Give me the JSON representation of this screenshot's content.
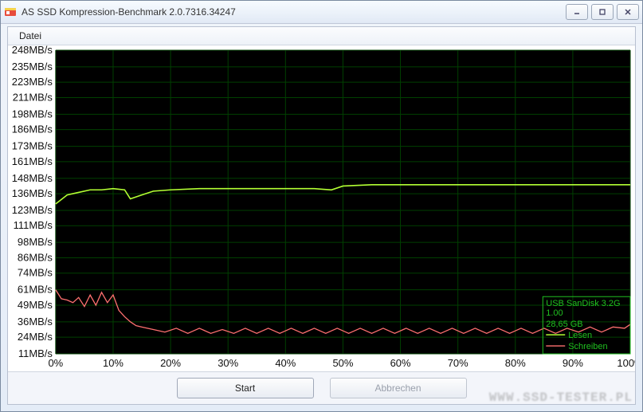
{
  "window": {
    "title": "AS SSD Kompression-Benchmark 2.0.7316.34247"
  },
  "menubar": {
    "file": "Datei"
  },
  "buttons": {
    "start": "Start",
    "cancel": "Abbrechen"
  },
  "legend": {
    "line1": "USB   SanDisk 3.2G",
    "line2": "1.00",
    "line3": "28,65 GB",
    "read": "Lesen",
    "write": "Schreiben"
  },
  "watermark": "WWW.SSD-TESTER.PL",
  "chart_data": {
    "type": "line",
    "xlabel": "",
    "ylabel": "",
    "x_ticks": [
      0,
      10,
      20,
      30,
      40,
      50,
      60,
      70,
      80,
      90,
      100
    ],
    "x_tick_labels": [
      "0%",
      "10%",
      "20%",
      "30%",
      "40%",
      "50%",
      "60%",
      "70%",
      "80%",
      "90%",
      "100%"
    ],
    "y_ticks": [
      11,
      24,
      36,
      49,
      61,
      74,
      86,
      98,
      111,
      123,
      136,
      148,
      161,
      173,
      186,
      198,
      211,
      223,
      235,
      248
    ],
    "y_tick_labels": [
      "11MB/s",
      "24MB/s",
      "36MB/s",
      "49MB/s",
      "61MB/s",
      "74MB/s",
      "86MB/s",
      "98MB/s",
      "111MB/s",
      "123MB/s",
      "136MB/s",
      "148MB/s",
      "161MB/s",
      "173MB/s",
      "186MB/s",
      "198MB/s",
      "211MB/s",
      "223MB/s",
      "235MB/s",
      "248MB/s"
    ],
    "xlim": [
      0,
      100
    ],
    "ylim": [
      11,
      248
    ],
    "series": [
      {
        "name": "Lesen",
        "color": "#b3ff33",
        "x": [
          0,
          2,
          4,
          6,
          8,
          10,
          12,
          13,
          15,
          17,
          20,
          25,
          30,
          35,
          40,
          45,
          48,
          50,
          55,
          60,
          65,
          70,
          75,
          80,
          85,
          90,
          95,
          100
        ],
        "values": [
          128,
          135,
          137,
          139,
          139,
          140,
          139,
          132,
          135,
          138,
          139,
          140,
          140,
          140,
          140,
          140,
          139,
          142,
          143,
          143,
          143,
          143,
          143,
          143,
          143,
          143,
          143,
          143
        ]
      },
      {
        "name": "Schreiben",
        "color": "#ff7070",
        "x": [
          0,
          1,
          2,
          3,
          4,
          5,
          6,
          7,
          8,
          9,
          10,
          11,
          12,
          13,
          14,
          15,
          17,
          19,
          21,
          23,
          25,
          27,
          29,
          31,
          33,
          35,
          37,
          39,
          41,
          43,
          45,
          47,
          49,
          51,
          53,
          55,
          57,
          59,
          61,
          63,
          65,
          67,
          69,
          71,
          73,
          75,
          77,
          79,
          81,
          83,
          85,
          87,
          89,
          91,
          93,
          95,
          97,
          99,
          100
        ],
        "values": [
          61,
          54,
          53,
          51,
          55,
          48,
          57,
          49,
          59,
          51,
          57,
          45,
          40,
          36,
          33,
          32,
          30,
          28,
          31,
          27,
          31,
          27,
          30,
          27,
          31,
          27,
          31,
          27,
          31,
          27,
          31,
          27,
          31,
          27,
          31,
          27,
          31,
          27,
          31,
          27,
          31,
          27,
          31,
          27,
          31,
          27,
          31,
          27,
          31,
          27,
          31,
          27,
          31,
          28,
          32,
          28,
          32,
          31,
          34
        ]
      }
    ]
  }
}
